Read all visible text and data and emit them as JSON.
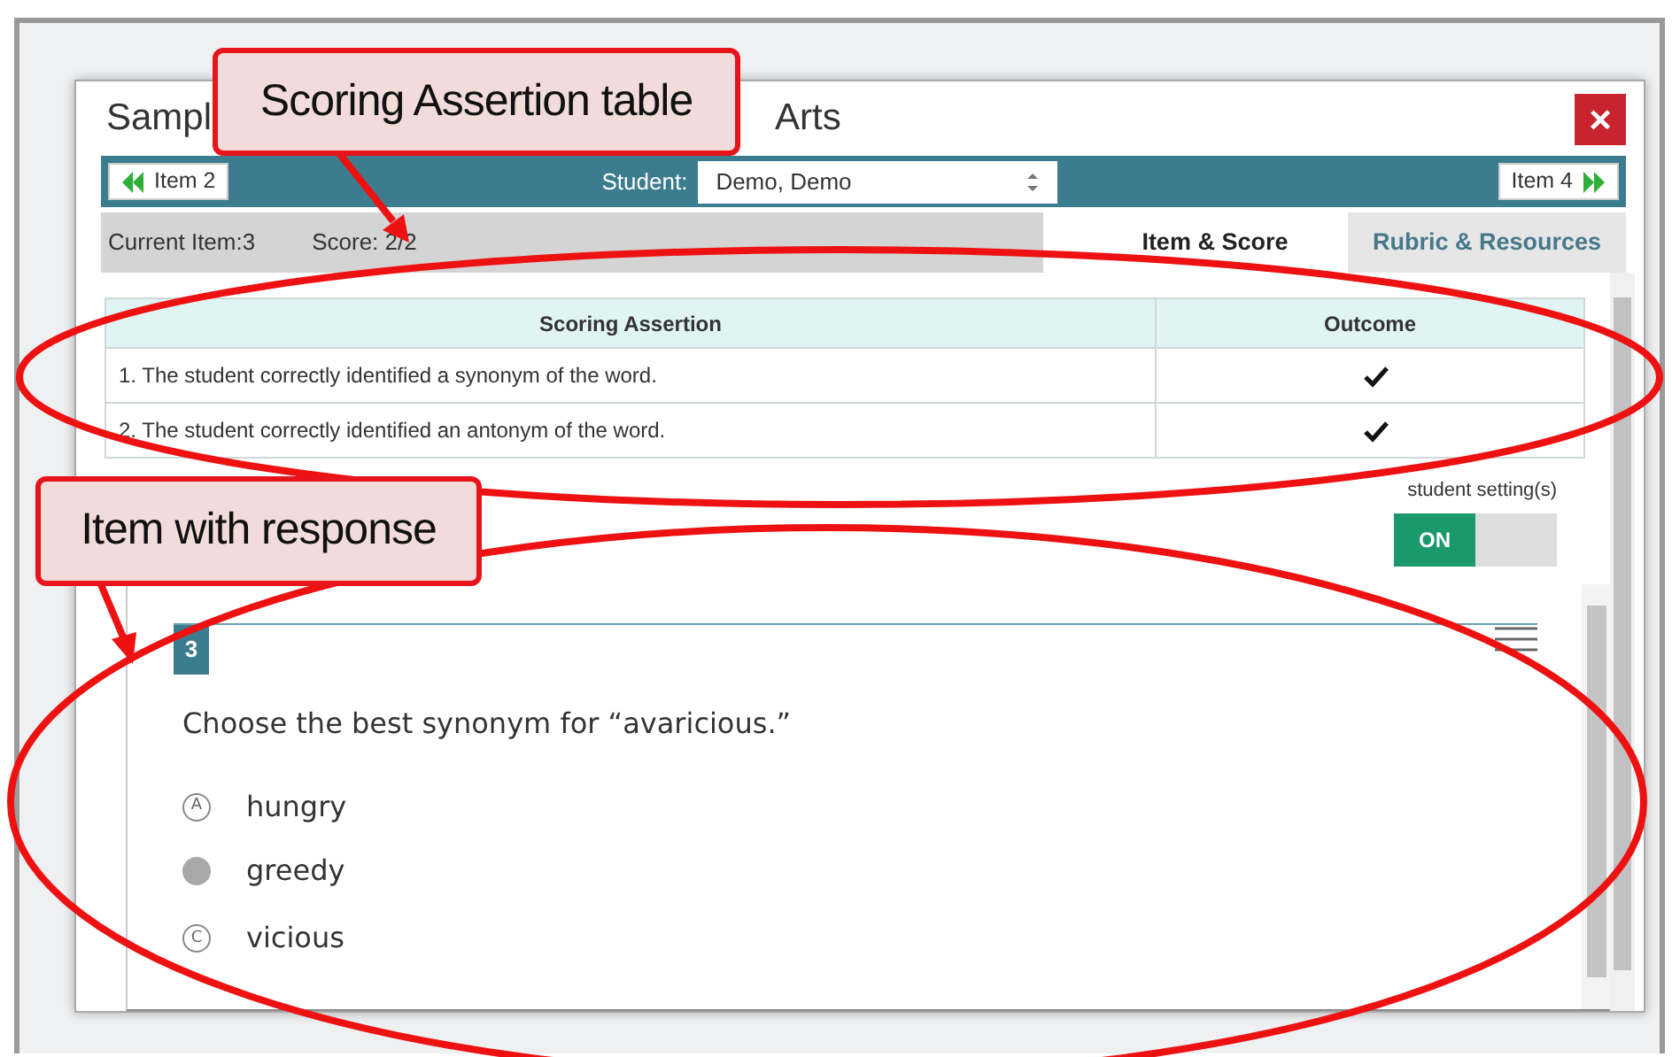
{
  "window": {
    "title_start": "Sampl",
    "title_end": "Arts",
    "close": "×"
  },
  "nav": {
    "prev": "Item 2",
    "student_label": "Student:",
    "student": "Demo, Demo",
    "next": "Item 4"
  },
  "info": {
    "current_item": "Current Item:3",
    "score": "Score: 2/2"
  },
  "tabs": [
    {
      "label": "Item & Score",
      "selected": true
    },
    {
      "label": "Rubric & Resources",
      "selected": false
    }
  ],
  "table": {
    "columns": [
      "Scoring Assertion",
      "Outcome"
    ],
    "rows": [
      {
        "assertion": "1. The student correctly identified a synonym of the word.",
        "met": true
      },
      {
        "assertion": "2. The student correctly identified an antonym of the word.",
        "met": true
      }
    ]
  },
  "setting": {
    "label": "student setting(s)",
    "state": "ON",
    "on": true
  },
  "item": {
    "number": "3",
    "question": "Choose the best synonym for “avaricious.”",
    "options": [
      {
        "letter": "A",
        "text": "hungry",
        "selected": false
      },
      {
        "text": "greedy",
        "selected": true
      },
      {
        "letter": "C",
        "text": "vicious",
        "selected": false
      }
    ]
  },
  "annotations": [
    {
      "kind": "table",
      "text": "Scoring Assertion table"
    },
    {
      "kind": "item",
      "text": "Item with response"
    }
  ]
}
